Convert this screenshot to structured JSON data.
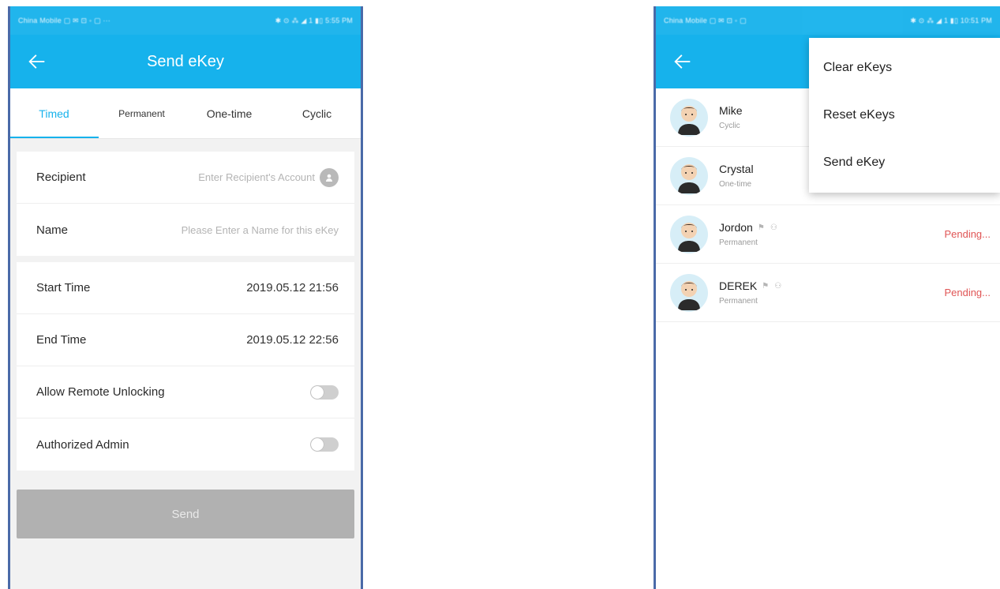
{
  "left": {
    "status_left": "China Mobile ▢ ✉ ⊡ ◦ ▢ ···",
    "status_right": "✱ ⊙ ⁂ ◢ 1 ▮▯ 5:55 PM",
    "title": "Send eKey",
    "tabs": [
      {
        "label": "Timed",
        "active": true
      },
      {
        "label": "Permanent",
        "active": false
      },
      {
        "label": "One-time",
        "active": false
      },
      {
        "label": "Cyclic",
        "active": false
      }
    ],
    "recipient": {
      "label": "Recipient",
      "placeholder": "Enter Recipient's Account"
    },
    "name": {
      "label": "Name",
      "placeholder": "Please Enter a Name for this eKey"
    },
    "start_time": {
      "label": "Start Time",
      "value": "2019.05.12 21:56"
    },
    "end_time": {
      "label": "End Time",
      "value": "2019.05.12 22:56"
    },
    "allow_remote": {
      "label": "Allow Remote Unlocking",
      "on": false
    },
    "authorized_admin": {
      "label": "Authorized Admin",
      "on": false
    },
    "send_label": "Send"
  },
  "right": {
    "status_left": "China Mobile ▢ ✉ ⊡ ◦ ▢",
    "status_right": "✱ ⊙ ⁂ ◢ 1 ▮▯ 10:51 PM",
    "menu": [
      "Clear eKeys",
      "Reset eKeys",
      "Send eKey"
    ],
    "keys": [
      {
        "name": "Mike",
        "type": "Cyclic",
        "status": ""
      },
      {
        "name": "Crystal",
        "type": "One-time",
        "status": ""
      },
      {
        "name": "Jordon",
        "type": "Permanent",
        "status": "Pending..."
      },
      {
        "name": "DEREK",
        "type": "Permanent",
        "status": "Pending..."
      }
    ]
  },
  "colors": {
    "accent": "#16b2ec",
    "pending": "#e05555",
    "disabled_button": "#b1b1b1"
  }
}
